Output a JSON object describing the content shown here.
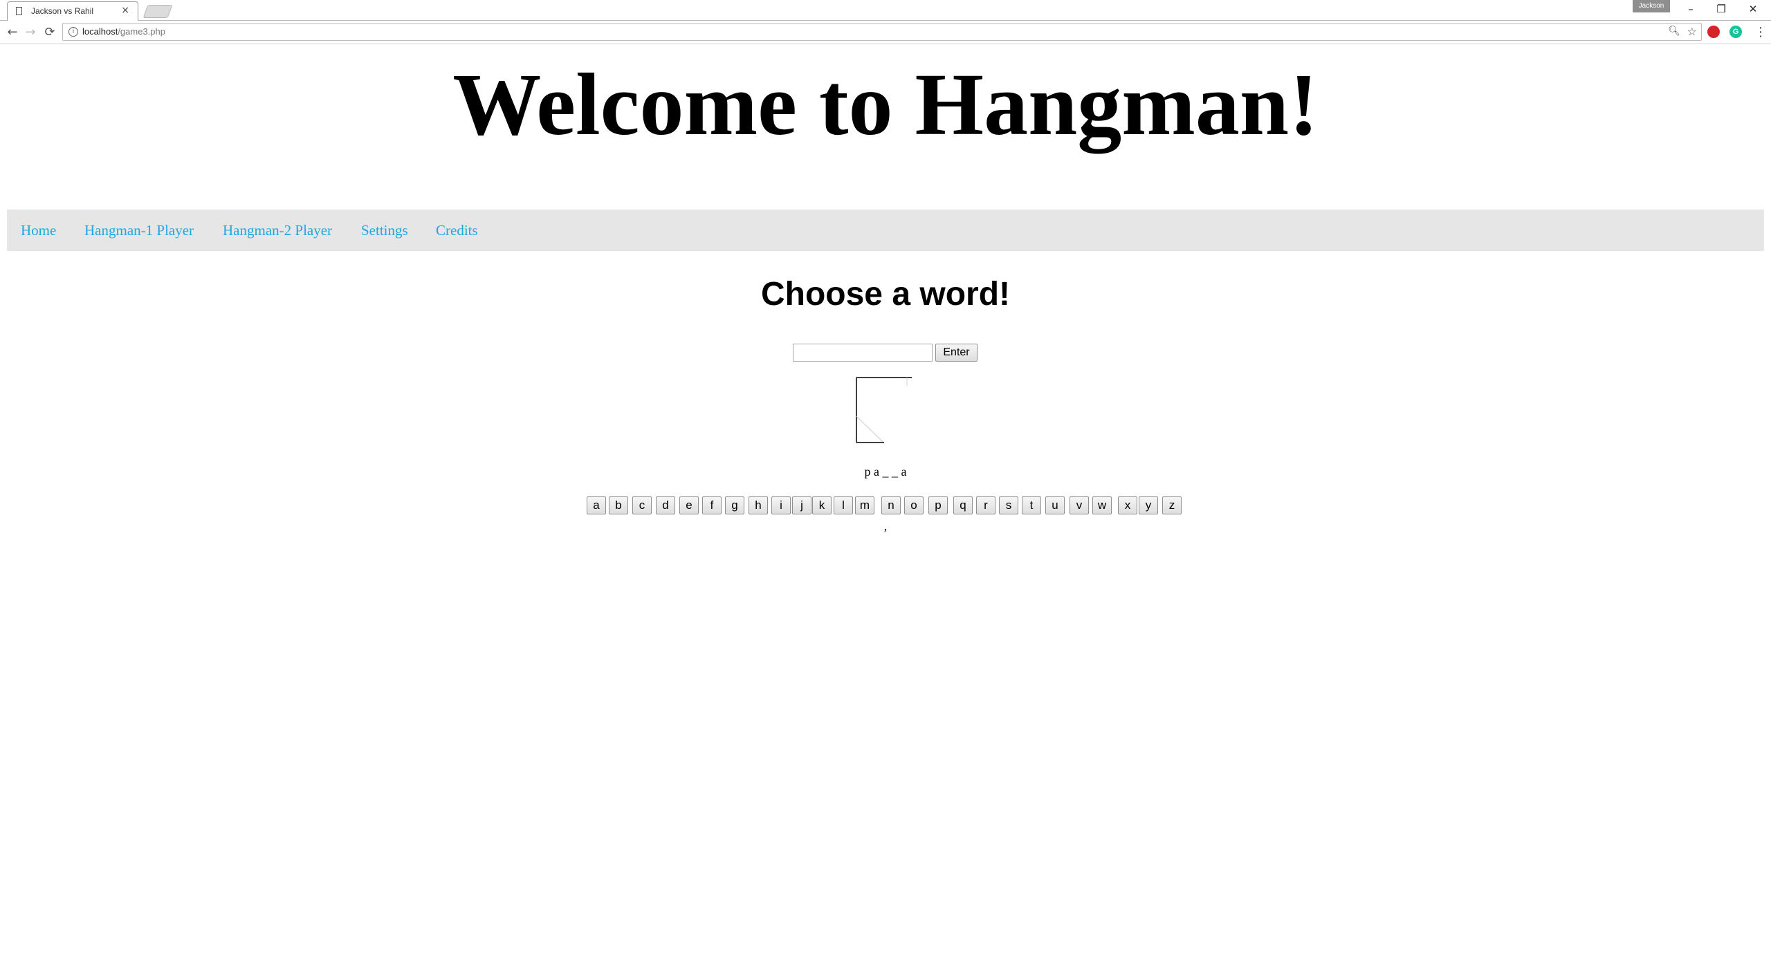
{
  "browser": {
    "tab_title": "Jackson vs Rahil",
    "tab_close": "×",
    "profile_name": "Jackson",
    "url_host": "localhost",
    "url_path": "/game3.php",
    "window_controls": {
      "minimize": "–",
      "restore": "❐",
      "close": "✕"
    },
    "nav": {
      "back": "←",
      "forward": "→",
      "reload": "⟳"
    },
    "icons": {
      "zoom": "zoom-icon",
      "star": "bookmark-star-icon",
      "ext1": "opera-extension-icon",
      "ext2": "grammarly-extension-icon",
      "menu": "kebab-menu-icon"
    },
    "ext1_letter": "",
    "ext2_letter": "G",
    "menu_glyph": "⋮"
  },
  "page": {
    "main_heading": "Welcome to Hangman!",
    "nav_links": [
      {
        "label": "Home"
      },
      {
        "label": "Hangman-1 Player"
      },
      {
        "label": "Hangman-2 Player"
      },
      {
        "label": "Settings"
      },
      {
        "label": "Credits"
      }
    ],
    "subheading": "Choose a word!",
    "word_input_value": "",
    "enter_label": "Enter",
    "word_display": "p a _ _ a",
    "letters": [
      "a",
      "b",
      "c",
      "d",
      "e",
      "f",
      "g",
      "h",
      "i",
      "j",
      "k",
      "l",
      "m",
      "n",
      "o",
      "p",
      "q",
      "r",
      "s",
      "t",
      "u",
      "v",
      "w",
      "x",
      "y",
      "z"
    ],
    "guessed_text": ","
  },
  "colors": {
    "nav_link": "#1ea7e0",
    "nav_background": "#e6e6e6"
  }
}
